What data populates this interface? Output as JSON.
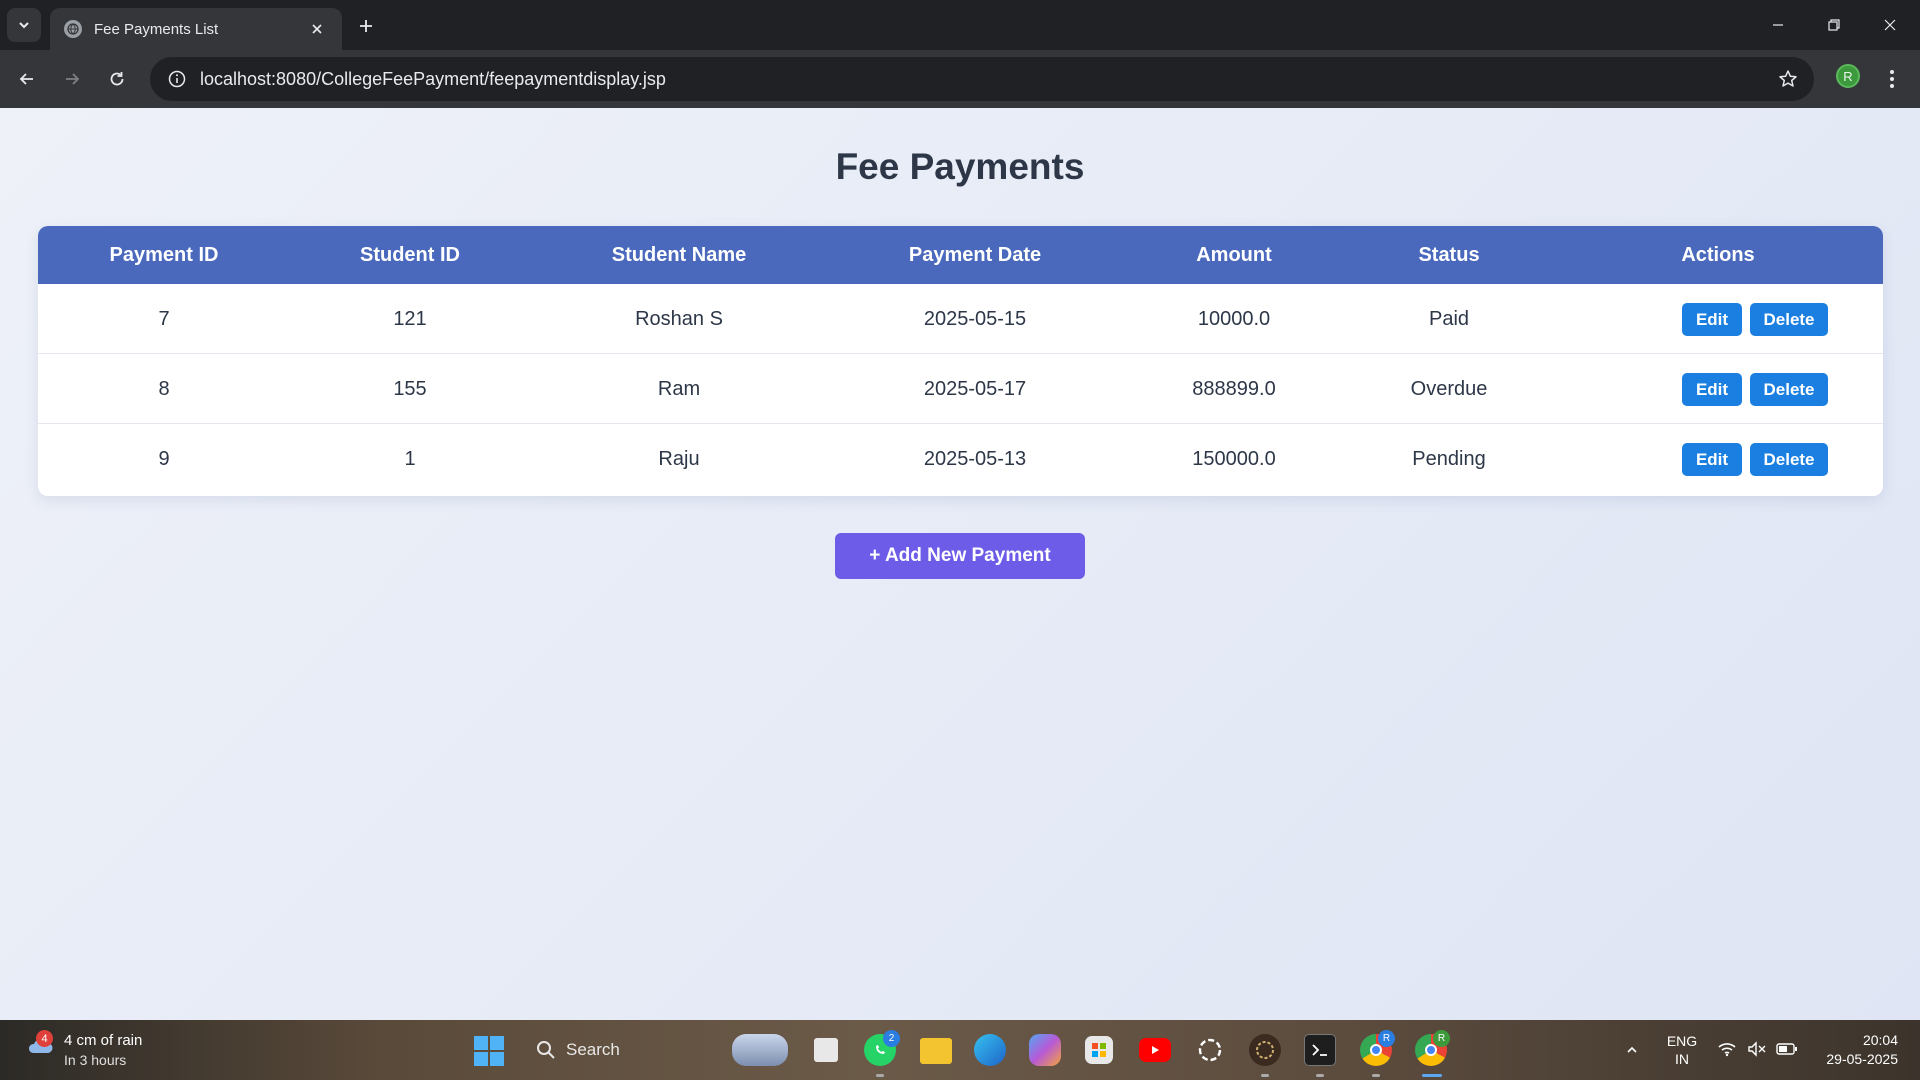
{
  "browser": {
    "tab_title": "Fee Payments List",
    "url": "localhost:8080/CollegeFeePayment/feepaymentdisplay.jsp",
    "profile_initial": "R"
  },
  "page": {
    "title": "Fee Payments",
    "add_button": "+ Add New Payment"
  },
  "table": {
    "headers": [
      "Payment ID",
      "Student ID",
      "Student Name",
      "Payment Date",
      "Amount",
      "Status",
      "Actions"
    ],
    "rows": [
      {
        "payment_id": "7",
        "student_id": "121",
        "student_name": "Roshan S",
        "payment_date": "2025-05-15",
        "amount": "10000.0",
        "status": "Paid",
        "edit": "Edit",
        "delete": "Delete"
      },
      {
        "payment_id": "8",
        "student_id": "155",
        "student_name": "Ram",
        "payment_date": "2025-05-17",
        "amount": "888899.0",
        "status": "Overdue",
        "edit": "Edit",
        "delete": "Delete"
      },
      {
        "payment_id": "9",
        "student_id": "1",
        "student_name": "Raju",
        "payment_date": "2025-05-13",
        "amount": "150000.0",
        "status": "Pending",
        "edit": "Edit",
        "delete": "Delete"
      }
    ]
  },
  "taskbar": {
    "weather_line1": "4 cm of rain",
    "weather_line2": "In 3 hours",
    "weather_badge": "4",
    "search_label": "Search",
    "whatsapp_badge": "2",
    "lang_line1": "ENG",
    "lang_line2": "IN",
    "time": "20:04",
    "date": "29-05-2025",
    "chrome_profile_1": "R",
    "chrome_profile_2": "R"
  },
  "colors": {
    "table_header": "#4a69bd",
    "action_button": "#1a7fe0",
    "add_button": "#6c5ce7",
    "page_title": "#2d3748"
  }
}
